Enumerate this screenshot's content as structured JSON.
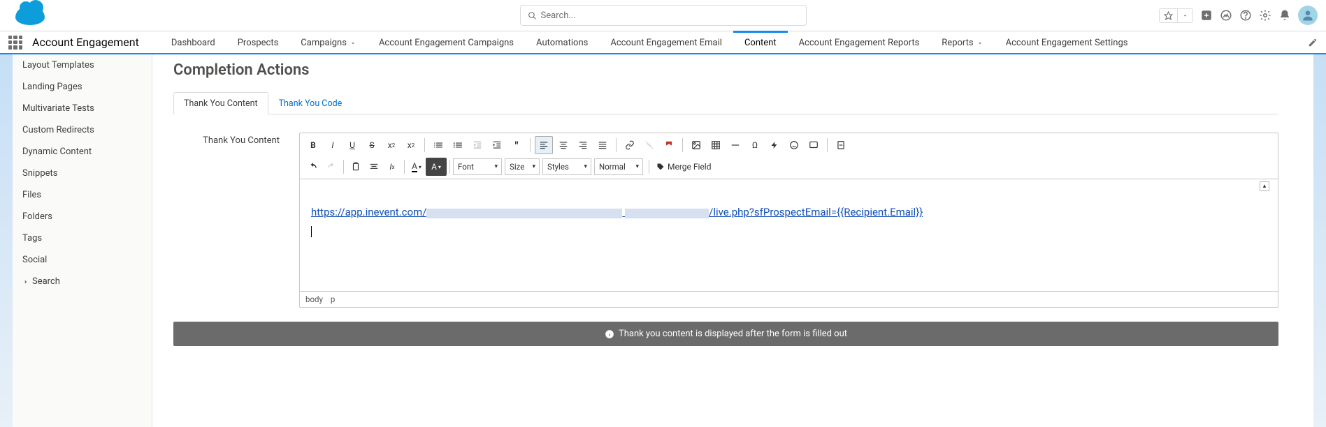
{
  "header": {
    "search_placeholder": "Search...",
    "app_name": "Account Engagement"
  },
  "nav": {
    "items": [
      {
        "label": "Dashboard",
        "dropdown": false
      },
      {
        "label": "Prospects",
        "dropdown": false
      },
      {
        "label": "Campaigns",
        "dropdown": true
      },
      {
        "label": "Account Engagement Campaigns",
        "dropdown": false
      },
      {
        "label": "Automations",
        "dropdown": false
      },
      {
        "label": "Account Engagement Email",
        "dropdown": false
      },
      {
        "label": "Content",
        "dropdown": false,
        "active": true
      },
      {
        "label": "Account Engagement Reports",
        "dropdown": false
      },
      {
        "label": "Reports",
        "dropdown": true
      },
      {
        "label": "Account Engagement Settings",
        "dropdown": false
      }
    ]
  },
  "sidebar": {
    "items": [
      {
        "label": "Layout Templates"
      },
      {
        "label": "Landing Pages"
      },
      {
        "label": "Multivariate Tests"
      },
      {
        "label": "Custom Redirects"
      },
      {
        "label": "Dynamic Content"
      },
      {
        "label": "Snippets"
      },
      {
        "label": "Files"
      },
      {
        "label": "Folders"
      },
      {
        "label": "Tags"
      },
      {
        "label": "Social"
      },
      {
        "label": "Search",
        "chevron": true
      }
    ]
  },
  "page": {
    "title": "Completion Actions",
    "tabs": [
      {
        "label": "Thank You Content",
        "active": true
      },
      {
        "label": "Thank You Code",
        "active": false
      }
    ],
    "form_label": "Thank You Content"
  },
  "editor": {
    "toolbar": {
      "font_label": "Font",
      "size_label": "Size",
      "styles_label": "Styles",
      "format_label": "Normal",
      "merge_field_label": "Merge Field"
    },
    "content": {
      "url_prefix": "https://app.inevent.com/",
      "url_suffix": "/live.php?sfProspectEmail={{Recipient.Email}}"
    },
    "path": {
      "body": "body",
      "p": "p"
    }
  },
  "banner": {
    "text": "Thank you content is displayed after the form is filled out"
  }
}
